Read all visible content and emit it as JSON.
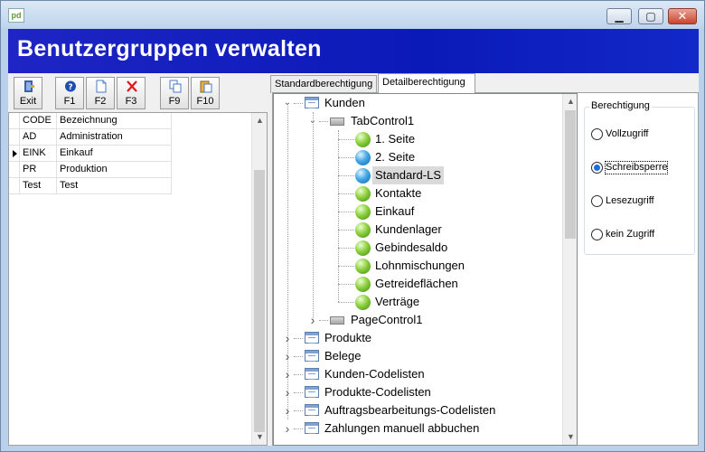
{
  "window": {
    "app_icon_text": "pd",
    "title": ""
  },
  "banner": {
    "title": "Benutzergruppen verwalten"
  },
  "toolbar": {
    "buttons": [
      {
        "label": "Exit",
        "icon": "exit-door-icon"
      },
      {
        "label": "F1",
        "icon": "help-icon"
      },
      {
        "label": "F2",
        "icon": "new-document-icon"
      },
      {
        "label": "F3",
        "icon": "delete-x-icon"
      },
      {
        "label": "F9",
        "icon": "copy-icon"
      },
      {
        "label": "F10",
        "icon": "clipboard-icon"
      }
    ]
  },
  "grid": {
    "headers": [
      "CODE",
      "Bezeichnung"
    ],
    "rows": [
      {
        "code": "AD",
        "name": "Administration",
        "current": false
      },
      {
        "code": "EINK",
        "name": "Einkauf",
        "current": true
      },
      {
        "code": "PR",
        "name": "Produktion",
        "current": false
      },
      {
        "code": "Test",
        "name": "Test",
        "current": false
      }
    ]
  },
  "tabs": [
    {
      "label": "Standardberechtigung",
      "active": false
    },
    {
      "label": "Detailberechtigung",
      "active": true
    }
  ],
  "tree": {
    "root": {
      "label": "Kunden",
      "expanded": true
    },
    "tabcontrol": {
      "label": "TabControl1",
      "expanded": true
    },
    "pages": [
      {
        "label": "1. Seite",
        "color": "green",
        "selected": false
      },
      {
        "label": "2. Seite",
        "color": "blue",
        "selected": false
      },
      {
        "label": "Standard-LS",
        "color": "blue",
        "selected": true
      },
      {
        "label": "Kontakte",
        "color": "green",
        "selected": false
      },
      {
        "label": "Einkauf",
        "color": "green",
        "selected": false
      },
      {
        "label": "Kundenlager",
        "color": "green",
        "selected": false
      },
      {
        "label": "Gebindesaldo",
        "color": "green",
        "selected": false
      },
      {
        "label": "Lohnmischungen",
        "color": "green",
        "selected": false
      },
      {
        "label": "Getreideflächen",
        "color": "green",
        "selected": false
      },
      {
        "label": "Verträge",
        "color": "green",
        "selected": false
      }
    ],
    "pagecontrol": {
      "label": "PageControl1",
      "expanded": false
    },
    "roots": [
      {
        "label": "Produkte"
      },
      {
        "label": "Belege"
      },
      {
        "label": "Kunden-Codelisten"
      },
      {
        "label": "Produkte-Codelisten"
      },
      {
        "label": "Auftragsbearbeitungs-Codelisten"
      },
      {
        "label": "Zahlungen manuell abbuchen"
      }
    ]
  },
  "permission": {
    "title": "Berechtigung",
    "options": [
      {
        "label": "Vollzugriff",
        "checked": false
      },
      {
        "label": "Schreibsperre",
        "checked": true
      },
      {
        "label": "Lesezugriff",
        "checked": false
      },
      {
        "label": "kein Zugriff",
        "checked": false
      }
    ]
  },
  "colors": {
    "banner": "#0a1ab8",
    "selected_radio": "#1a6fe0"
  }
}
